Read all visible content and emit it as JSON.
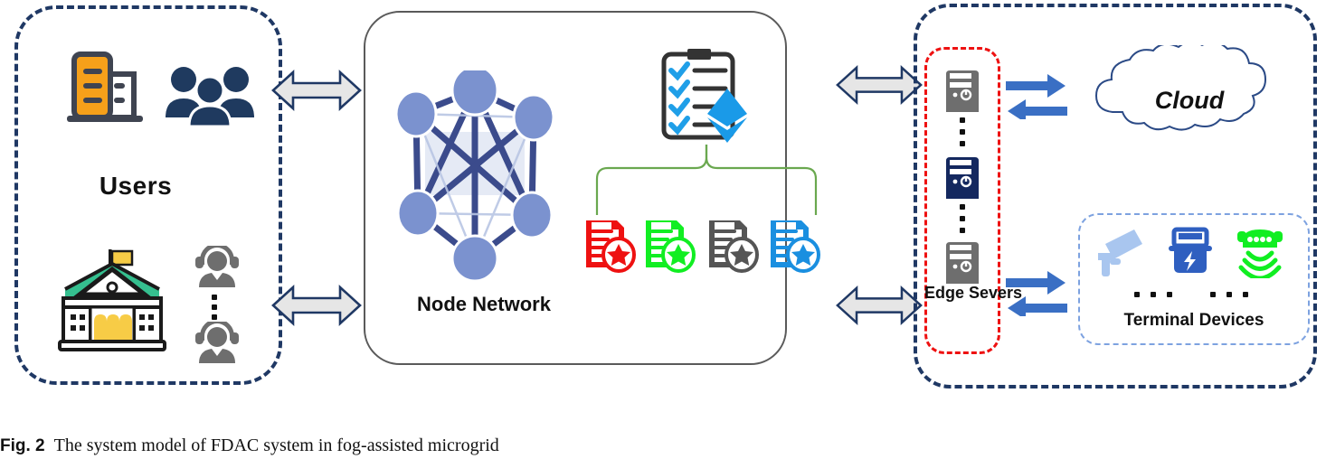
{
  "figure": {
    "caption_number": "Fig. 2",
    "caption_text": "The system model of FDAC system in fog-assisted microgrid"
  },
  "colors": {
    "panel_dash_navy": "#1f3864",
    "panel_center_border": "#5a5a5a",
    "edge_panel_dash_red": "#ee1111",
    "terminal_panel_dash_blue": "#7da2e0",
    "arrow_fill_gray": "#e6e6e6",
    "arrow_outline_navy": "#1f3864",
    "arrow_solid_blue": "#3a6fc4",
    "node_fill_blue": "#7b92cf",
    "node_edge_blue": "#3b4b8c",
    "building_orange": "#f6a01a",
    "people_navy": "#1f3a5f",
    "gov_roof_teal": "#35bf8f",
    "gov_door_yellow": "#f7cc46",
    "operator_gray": "#6e6e6e",
    "server_gray": "#6e6e6e",
    "server_navy": "#14285f",
    "cert_red": "#ee1111",
    "cert_green": "#11ee22",
    "cert_gray": "#555555",
    "cert_blue": "#1a8fe0",
    "brace_green": "#6aa84f",
    "ethereum_blue": "#1a9ae8",
    "check_blue": "#1f9fe8",
    "clipboard_dark": "#333333",
    "cctv_lightblue": "#a9c6ef",
    "meter_blue": "#2f5fc0",
    "sensor_green": "#11ee22",
    "cloud_outline": "#2b4a86"
  },
  "left_panel": {
    "name": "Users domain",
    "label": "Users",
    "icons": [
      {
        "name": "office-building-icon",
        "desc": "orange office building"
      },
      {
        "name": "people-group-icon",
        "desc": "three navy persons"
      },
      {
        "name": "government-building-icon",
        "desc": "institution with teal roof and flag"
      },
      {
        "name": "operator-icon-top",
        "desc": "gray headset operator"
      },
      {
        "name": "operator-icon-bottom",
        "desc": "gray headset operator"
      }
    ],
    "ellipsis_dots": 3
  },
  "center_panel": {
    "name": "Blockchain / node network domain",
    "node_network_label": "Node Network",
    "node_count": 6,
    "clipboard": {
      "name": "smart-contract-clipboard-icon",
      "check_rows": 4,
      "badge": "ethereum-diamond-icon"
    },
    "brace": {
      "name": "green-curly-brace",
      "branch_count": 4
    },
    "certificates": [
      {
        "name": "certificate-red",
        "color": "#ee1111"
      },
      {
        "name": "certificate-green",
        "color": "#11ee22"
      },
      {
        "name": "certificate-gray",
        "color": "#555555"
      },
      {
        "name": "certificate-blue",
        "color": "#1a8fe0"
      }
    ]
  },
  "right_panel": {
    "name": "Fog / cloud domain",
    "edge_servers": {
      "label": "Edge Severs",
      "server_count": 3,
      "servers": [
        {
          "name": "edge-server-top",
          "color": "gray"
        },
        {
          "name": "edge-server-middle",
          "color": "navy"
        },
        {
          "name": "edge-server-bottom",
          "color": "gray"
        }
      ],
      "ellipsis_dots": 3
    },
    "cloud": {
      "label": "Cloud",
      "name": "cloud-shape"
    },
    "terminal_devices": {
      "label": "Terminal Devices",
      "devices": [
        {
          "name": "cctv-camera-icon",
          "desc": "surveillance camera"
        },
        {
          "name": "smart-meter-icon",
          "desc": "electric meter with bolt"
        },
        {
          "name": "wireless-sensor-icon",
          "desc": "green signal sensor"
        }
      ],
      "ellipsis_groups": 2,
      "dots_per_group": 3
    }
  },
  "connectors": {
    "bidirectional_gray": [
      {
        "name": "arrow-users-to-network-top",
        "style": "double-headed"
      },
      {
        "name": "arrow-users-to-network-bottom",
        "style": "double-headed"
      },
      {
        "name": "arrow-network-to-fog-top",
        "style": "double-headed"
      },
      {
        "name": "arrow-network-to-fog-bottom",
        "style": "double-headed"
      }
    ],
    "blue_pairs": [
      {
        "name": "arrow-edge-to-cloud",
        "directions": [
          "right",
          "left"
        ]
      },
      {
        "name": "arrow-edge-to-terminal",
        "directions": [
          "right",
          "left"
        ]
      }
    ]
  }
}
